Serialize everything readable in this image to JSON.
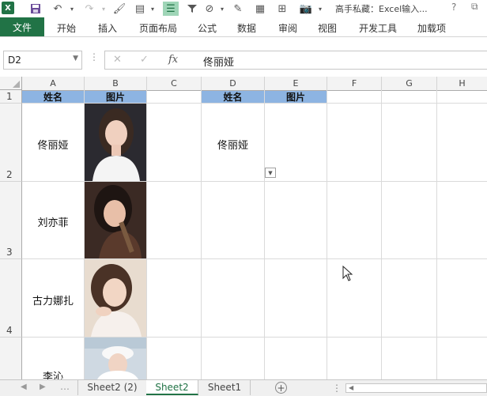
{
  "window": {
    "title": "高手私藏：Excel输入...",
    "help": "?"
  },
  "ribbon": {
    "tabs": [
      "文件",
      "开始",
      "插入",
      "页面布局",
      "公式",
      "数据",
      "审阅",
      "视图",
      "开发工具",
      "加载项"
    ]
  },
  "formula_bar": {
    "name_box": "D2",
    "value": "佟丽娅",
    "fx": "fx"
  },
  "columns": [
    "A",
    "B",
    "C",
    "D",
    "E",
    "F",
    "G",
    "H"
  ],
  "rows": [
    "1",
    "2",
    "3",
    "4"
  ],
  "table_left": {
    "headers": [
      "姓名",
      "图片"
    ],
    "rows": [
      {
        "name": "佟丽娅"
      },
      {
        "name": "刘亦菲"
      },
      {
        "name": "古力娜扎"
      },
      {
        "name": "李沁"
      }
    ]
  },
  "table_right": {
    "headers": [
      "姓名",
      "图片"
    ],
    "selected_name": "佟丽娅"
  },
  "sheet_tabs": [
    "Sheet2 (2)",
    "Sheet2",
    "Sheet1"
  ],
  "active_sheet": "Sheet2",
  "colors": {
    "accent": "#217346",
    "header_fill": "#8db4e2"
  }
}
